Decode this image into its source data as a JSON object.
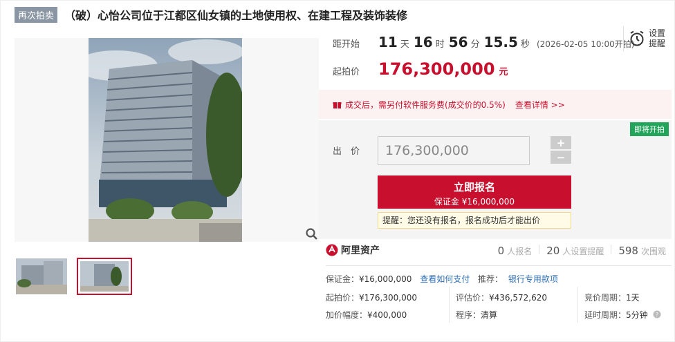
{
  "title": {
    "badge": "再次拍卖",
    "text": "（破）心怡公司位于江都区仙女镇的土地使用权、在建工程及装饰装修"
  },
  "countdown": {
    "label": "距开始",
    "days": "11",
    "days_unit": "天",
    "hours": "16",
    "hours_unit": "时",
    "minutes": "56",
    "minutes_unit": "分",
    "seconds": "15.5",
    "seconds_unit": "秒",
    "start_note": "(2026-02-05 10:00开拍)"
  },
  "remind": {
    "label_line1": "设置",
    "label_line2": "提醒",
    "icon": "alarm-clock-icon"
  },
  "start_price": {
    "label": "起拍价",
    "value": "176,300,000",
    "unit": "元"
  },
  "fee_notice": {
    "text": "成交后，需另付软件服务费(成交价的0.5%)",
    "link": "查看详情 >>",
    "icon": "gift-icon"
  },
  "status_tag": "即将开拍",
  "bid": {
    "label": "出　价",
    "value": "176,300,000",
    "plus": "+",
    "minus": "−"
  },
  "apply_button": {
    "title": "立即报名",
    "deposit": "保证金 ¥16,000,000"
  },
  "tip": "提醒：您还没有报名，报名成功后才能出价",
  "platform": {
    "name": "阿里资产"
  },
  "stats": [
    {
      "num": "0",
      "label": "人报名"
    },
    {
      "num": "20",
      "label": "人设置提醒"
    },
    {
      "num": "598",
      "label": "次围观"
    }
  ],
  "details": {
    "deposit_label": "保证金：",
    "deposit_value": "¥16,000,000",
    "pay_link": "查看如何支付",
    "recommend_label": "推荐：",
    "recommend_link": "银行专用款项",
    "start_label": "起拍价：",
    "start_value": "¥176,300,000",
    "eval_label": "评估价：",
    "eval_value": "¥436,572,620",
    "cycle_label": "竞价周期：",
    "cycle_value": "1天",
    "increment_label": "加价幅度：",
    "increment_value": "¥400,000",
    "procedure_label": "程序：",
    "procedure_value": "清算",
    "delay_label": "延时周期：",
    "delay_value": "5分钟"
  },
  "colors": {
    "accent": "#c8102e",
    "link": "#2f6fb5",
    "green_tag": "#23a45b"
  }
}
